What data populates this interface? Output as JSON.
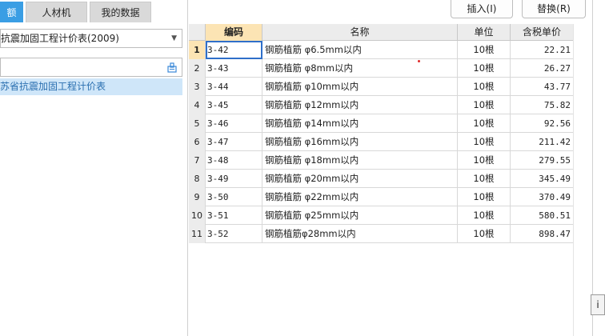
{
  "tabs": [
    {
      "label": "额"
    },
    {
      "label": "人材机"
    },
    {
      "label": "我的数据"
    }
  ],
  "left": {
    "selected_library": "抗震加固工程计价表(2009)",
    "search_value": "",
    "tree_item": "苏省抗震加固工程计价表"
  },
  "actions": {
    "insert": "插入(I)",
    "replace": "替换(R)"
  },
  "table": {
    "headers": {
      "code": "编码",
      "name": "名称",
      "unit": "单位",
      "price": "含税单价"
    },
    "rows": [
      {
        "no": "1",
        "code": "3-42",
        "name": "钢筋植筋 φ6.5mm以内",
        "unit": "10根",
        "price": "22.21"
      },
      {
        "no": "2",
        "code": "3-43",
        "name": "钢筋植筋 φ8mm以内",
        "unit": "10根",
        "price": "26.27"
      },
      {
        "no": "3",
        "code": "3-44",
        "name": "钢筋植筋 φ10mm以内",
        "unit": "10根",
        "price": "43.77"
      },
      {
        "no": "4",
        "code": "3-45",
        "name": "钢筋植筋 φ12mm以内",
        "unit": "10根",
        "price": "75.82"
      },
      {
        "no": "5",
        "code": "3-46",
        "name": "钢筋植筋 φ14mm以内",
        "unit": "10根",
        "price": "92.56"
      },
      {
        "no": "6",
        "code": "3-47",
        "name": "钢筋植筋 φ16mm以内",
        "unit": "10根",
        "price": "211.42"
      },
      {
        "no": "7",
        "code": "3-48",
        "name": "钢筋植筋 φ18mm以内",
        "unit": "10根",
        "price": "279.55"
      },
      {
        "no": "8",
        "code": "3-49",
        "name": "钢筋植筋 φ20mm以内",
        "unit": "10根",
        "price": "345.49"
      },
      {
        "no": "9",
        "code": "3-50",
        "name": "钢筋植筋 φ22mm以内",
        "unit": "10根",
        "price": "370.49"
      },
      {
        "no": "10",
        "code": "3-51",
        "name": "钢筋植筋 φ25mm以内",
        "unit": "10根",
        "price": "580.51"
      },
      {
        "no": "11",
        "code": "3-52",
        "name": "钢筋植筋φ28mm以内",
        "unit": "10根",
        "price": "898.47"
      }
    ]
  },
  "edge_label": "i",
  "colors": {
    "accent": "#3a9ee4",
    "header_selected": "#fce4b4",
    "tree_selected": "#cfe6f9"
  },
  "icons": {
    "dropdown": "chevron-down-icon",
    "search": "search-icon"
  }
}
